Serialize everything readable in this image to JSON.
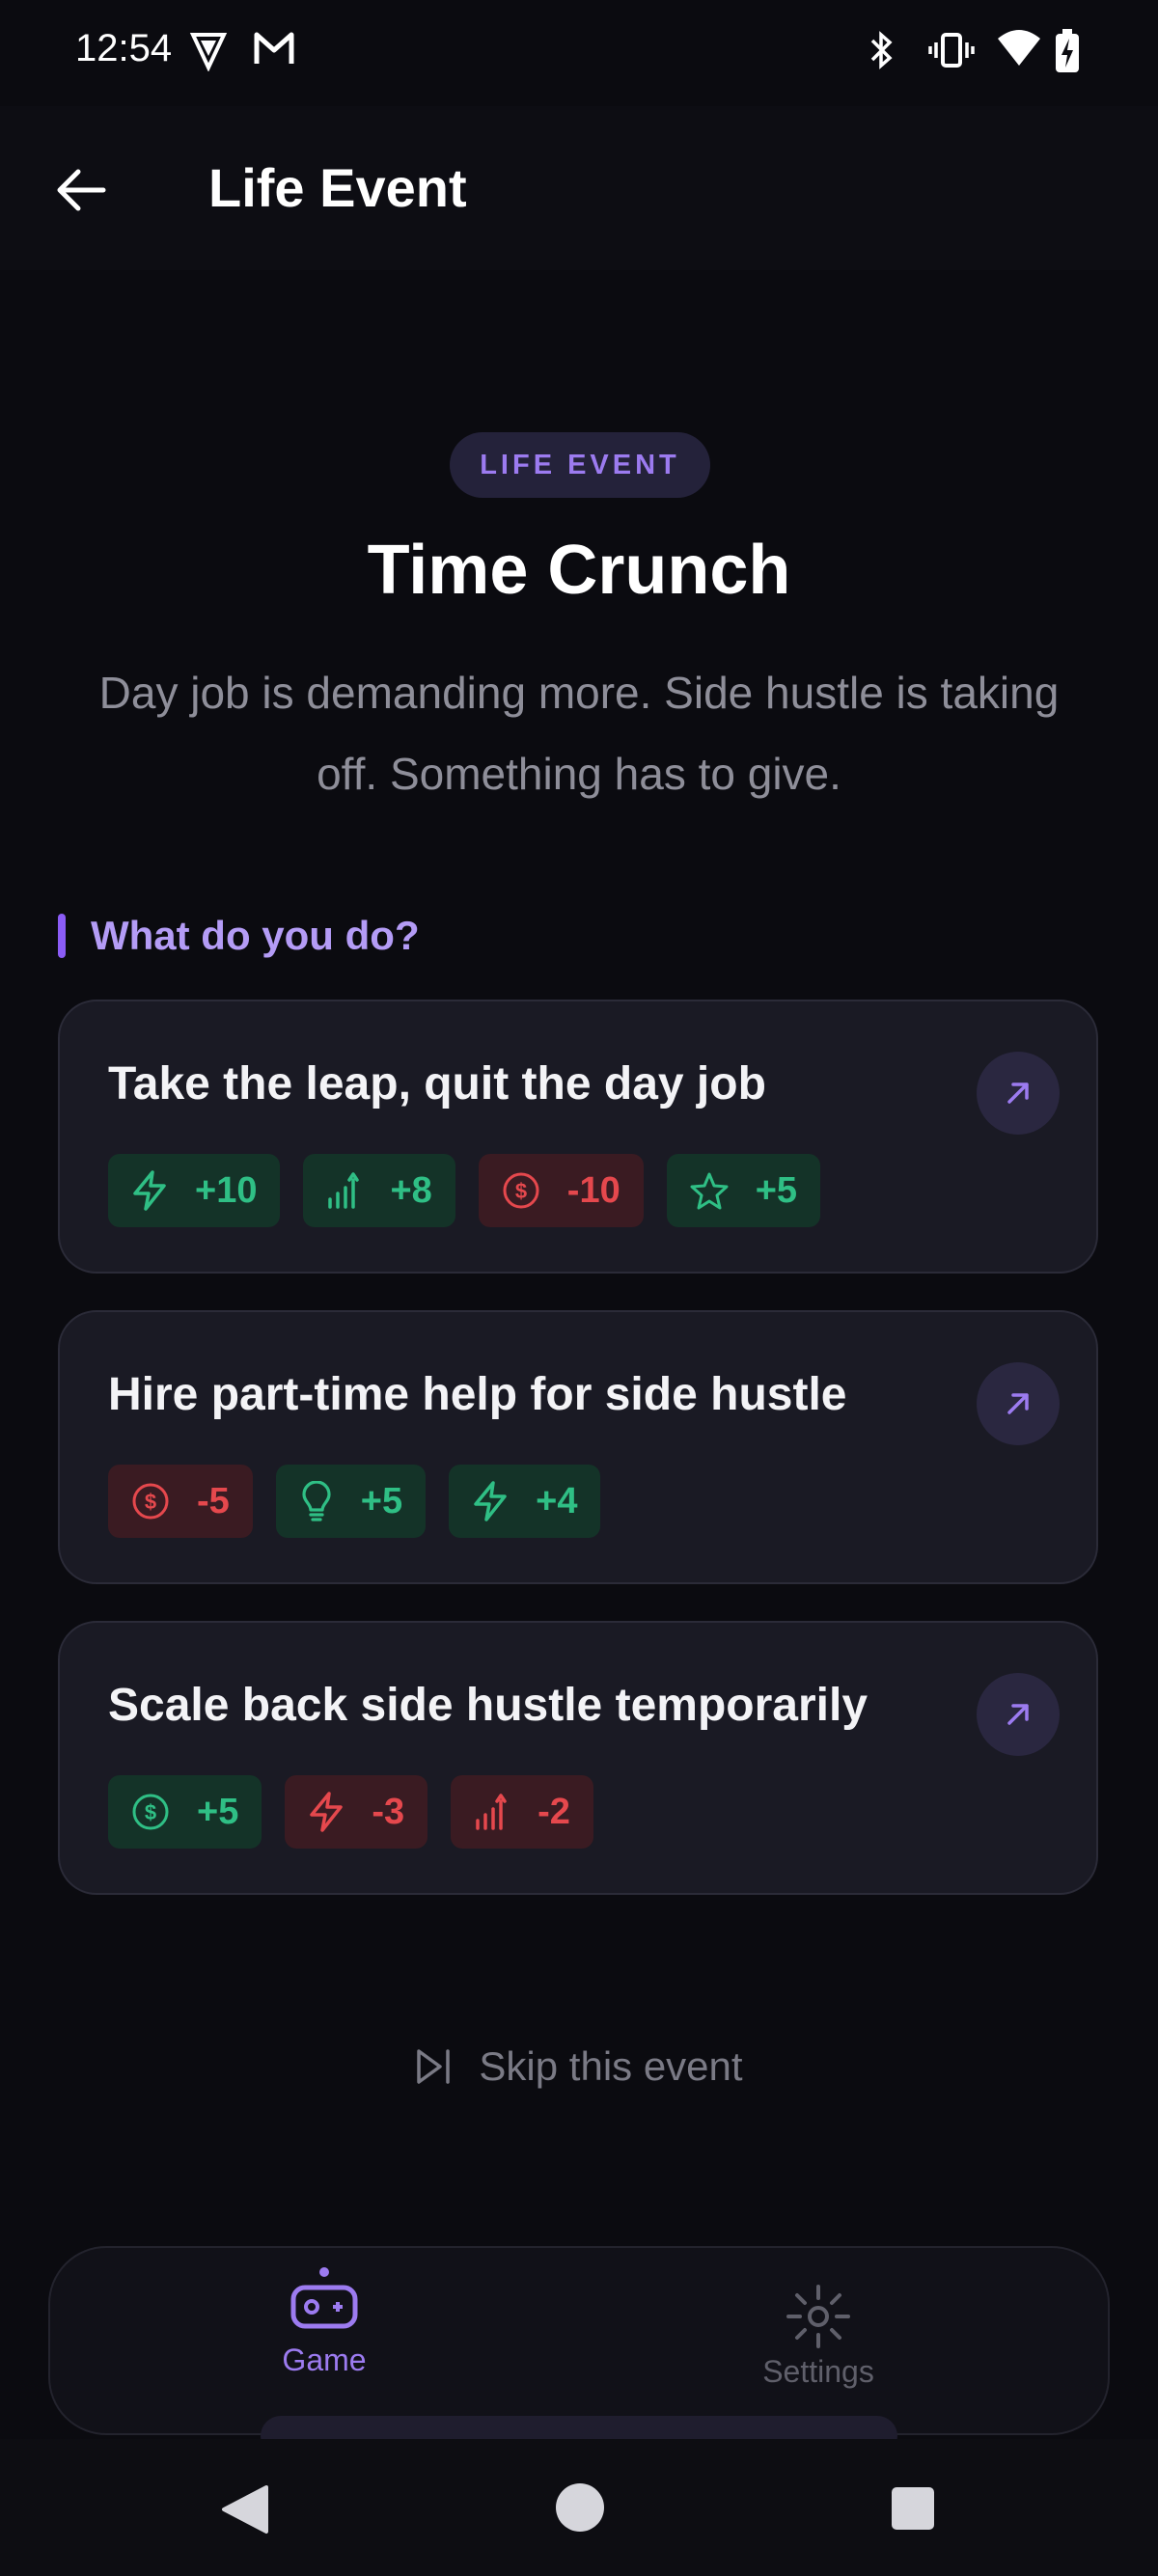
{
  "status_bar": {
    "time": "12:54"
  },
  "app_bar": {
    "title": "Life Event"
  },
  "event": {
    "badge": "LIFE EVENT",
    "title": "Time Crunch",
    "description": "Day job is demanding more. Side hustle is taking off. Something has to give."
  },
  "section": {
    "label": "What do you do?"
  },
  "choices": [
    {
      "title": "Take the leap, quit the day job",
      "effects": [
        {
          "icon": "lightning-icon",
          "value": "+10",
          "tone": "positive"
        },
        {
          "icon": "growth-bars-icon",
          "value": "+8",
          "tone": "positive"
        },
        {
          "icon": "money-icon",
          "value": "-10",
          "tone": "negative"
        },
        {
          "icon": "star-icon",
          "value": "+5",
          "tone": "positive"
        }
      ]
    },
    {
      "title": "Hire part-time help for side hustle",
      "effects": [
        {
          "icon": "money-icon",
          "value": "-5",
          "tone": "negative"
        },
        {
          "icon": "lightbulb-icon",
          "value": "+5",
          "tone": "positive"
        },
        {
          "icon": "lightning-icon",
          "value": "+4",
          "tone": "positive"
        }
      ]
    },
    {
      "title": "Scale back side hustle temporarily",
      "effects": [
        {
          "icon": "money-icon",
          "value": "+5",
          "tone": "positive"
        },
        {
          "icon": "lightning-icon",
          "value": "-3",
          "tone": "negative"
        },
        {
          "icon": "growth-bars-icon",
          "value": "-2",
          "tone": "negative"
        }
      ]
    }
  ],
  "skip": {
    "label": "Skip this event"
  },
  "bottom_nav": {
    "items": [
      {
        "label": "Game",
        "icon": "gamepad-icon",
        "active": true
      },
      {
        "label": "Settings",
        "icon": "gear-icon",
        "active": false
      }
    ]
  },
  "colors": {
    "accent": "#8b5cf6",
    "positive": "#2fbf85",
    "negative": "#e5484d",
    "background": "#0b0b10"
  }
}
